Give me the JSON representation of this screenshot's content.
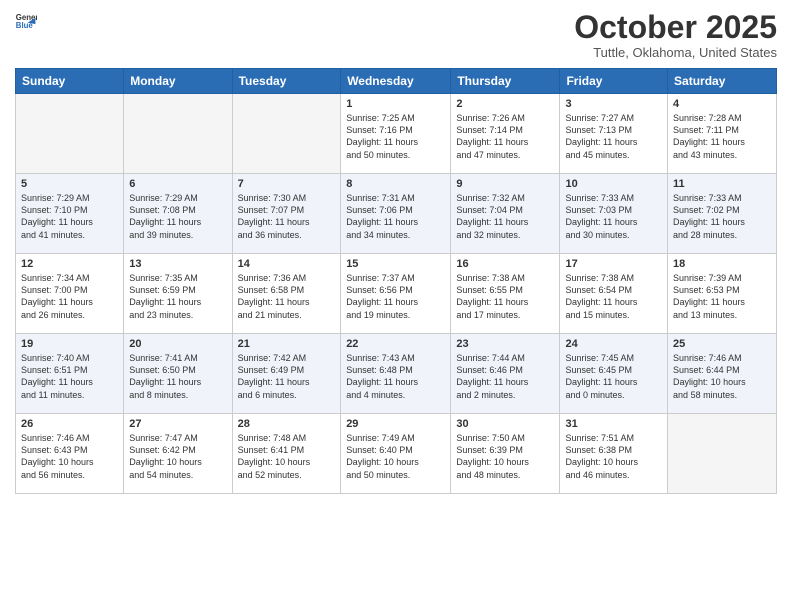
{
  "header": {
    "logo_line1": "General",
    "logo_line2": "Blue",
    "title": "October 2025",
    "location": "Tuttle, Oklahoma, United States"
  },
  "weekdays": [
    "Sunday",
    "Monday",
    "Tuesday",
    "Wednesday",
    "Thursday",
    "Friday",
    "Saturday"
  ],
  "weeks": [
    [
      {
        "day": "",
        "info": ""
      },
      {
        "day": "",
        "info": ""
      },
      {
        "day": "",
        "info": ""
      },
      {
        "day": "1",
        "info": "Sunrise: 7:25 AM\nSunset: 7:16 PM\nDaylight: 11 hours\nand 50 minutes."
      },
      {
        "day": "2",
        "info": "Sunrise: 7:26 AM\nSunset: 7:14 PM\nDaylight: 11 hours\nand 47 minutes."
      },
      {
        "day": "3",
        "info": "Sunrise: 7:27 AM\nSunset: 7:13 PM\nDaylight: 11 hours\nand 45 minutes."
      },
      {
        "day": "4",
        "info": "Sunrise: 7:28 AM\nSunset: 7:11 PM\nDaylight: 11 hours\nand 43 minutes."
      }
    ],
    [
      {
        "day": "5",
        "info": "Sunrise: 7:29 AM\nSunset: 7:10 PM\nDaylight: 11 hours\nand 41 minutes."
      },
      {
        "day": "6",
        "info": "Sunrise: 7:29 AM\nSunset: 7:08 PM\nDaylight: 11 hours\nand 39 minutes."
      },
      {
        "day": "7",
        "info": "Sunrise: 7:30 AM\nSunset: 7:07 PM\nDaylight: 11 hours\nand 36 minutes."
      },
      {
        "day": "8",
        "info": "Sunrise: 7:31 AM\nSunset: 7:06 PM\nDaylight: 11 hours\nand 34 minutes."
      },
      {
        "day": "9",
        "info": "Sunrise: 7:32 AM\nSunset: 7:04 PM\nDaylight: 11 hours\nand 32 minutes."
      },
      {
        "day": "10",
        "info": "Sunrise: 7:33 AM\nSunset: 7:03 PM\nDaylight: 11 hours\nand 30 minutes."
      },
      {
        "day": "11",
        "info": "Sunrise: 7:33 AM\nSunset: 7:02 PM\nDaylight: 11 hours\nand 28 minutes."
      }
    ],
    [
      {
        "day": "12",
        "info": "Sunrise: 7:34 AM\nSunset: 7:00 PM\nDaylight: 11 hours\nand 26 minutes."
      },
      {
        "day": "13",
        "info": "Sunrise: 7:35 AM\nSunset: 6:59 PM\nDaylight: 11 hours\nand 23 minutes."
      },
      {
        "day": "14",
        "info": "Sunrise: 7:36 AM\nSunset: 6:58 PM\nDaylight: 11 hours\nand 21 minutes."
      },
      {
        "day": "15",
        "info": "Sunrise: 7:37 AM\nSunset: 6:56 PM\nDaylight: 11 hours\nand 19 minutes."
      },
      {
        "day": "16",
        "info": "Sunrise: 7:38 AM\nSunset: 6:55 PM\nDaylight: 11 hours\nand 17 minutes."
      },
      {
        "day": "17",
        "info": "Sunrise: 7:38 AM\nSunset: 6:54 PM\nDaylight: 11 hours\nand 15 minutes."
      },
      {
        "day": "18",
        "info": "Sunrise: 7:39 AM\nSunset: 6:53 PM\nDaylight: 11 hours\nand 13 minutes."
      }
    ],
    [
      {
        "day": "19",
        "info": "Sunrise: 7:40 AM\nSunset: 6:51 PM\nDaylight: 11 hours\nand 11 minutes."
      },
      {
        "day": "20",
        "info": "Sunrise: 7:41 AM\nSunset: 6:50 PM\nDaylight: 11 hours\nand 8 minutes."
      },
      {
        "day": "21",
        "info": "Sunrise: 7:42 AM\nSunset: 6:49 PM\nDaylight: 11 hours\nand 6 minutes."
      },
      {
        "day": "22",
        "info": "Sunrise: 7:43 AM\nSunset: 6:48 PM\nDaylight: 11 hours\nand 4 minutes."
      },
      {
        "day": "23",
        "info": "Sunrise: 7:44 AM\nSunset: 6:46 PM\nDaylight: 11 hours\nand 2 minutes."
      },
      {
        "day": "24",
        "info": "Sunrise: 7:45 AM\nSunset: 6:45 PM\nDaylight: 11 hours\nand 0 minutes."
      },
      {
        "day": "25",
        "info": "Sunrise: 7:46 AM\nSunset: 6:44 PM\nDaylight: 10 hours\nand 58 minutes."
      }
    ],
    [
      {
        "day": "26",
        "info": "Sunrise: 7:46 AM\nSunset: 6:43 PM\nDaylight: 10 hours\nand 56 minutes."
      },
      {
        "day": "27",
        "info": "Sunrise: 7:47 AM\nSunset: 6:42 PM\nDaylight: 10 hours\nand 54 minutes."
      },
      {
        "day": "28",
        "info": "Sunrise: 7:48 AM\nSunset: 6:41 PM\nDaylight: 10 hours\nand 52 minutes."
      },
      {
        "day": "29",
        "info": "Sunrise: 7:49 AM\nSunset: 6:40 PM\nDaylight: 10 hours\nand 50 minutes."
      },
      {
        "day": "30",
        "info": "Sunrise: 7:50 AM\nSunset: 6:39 PM\nDaylight: 10 hours\nand 48 minutes."
      },
      {
        "day": "31",
        "info": "Sunrise: 7:51 AM\nSunset: 6:38 PM\nDaylight: 10 hours\nand 46 minutes."
      },
      {
        "day": "",
        "info": ""
      }
    ]
  ]
}
